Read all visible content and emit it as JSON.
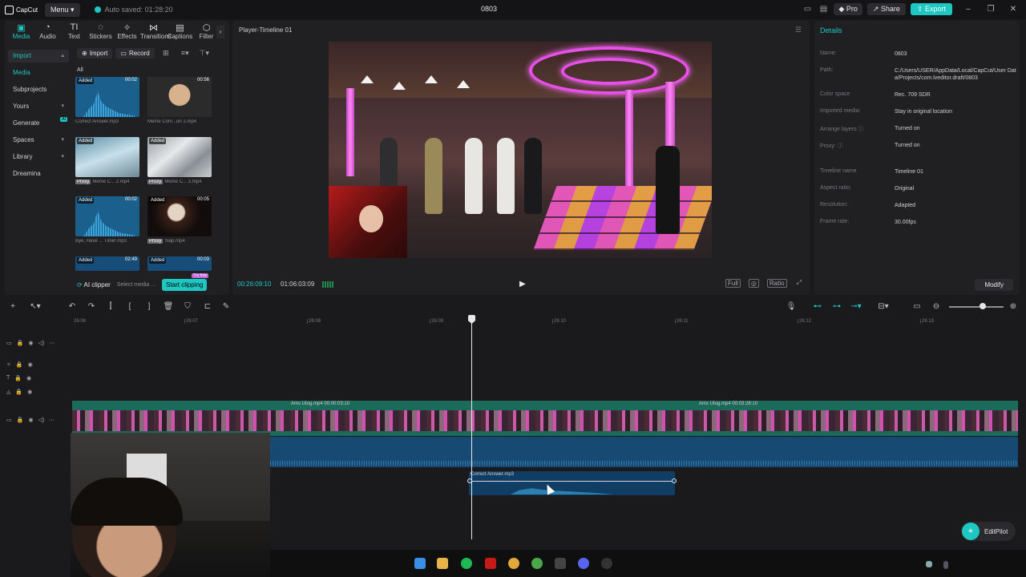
{
  "titlebar": {
    "logo": "CapCut",
    "menu": "Menu",
    "autosave": "Auto saved: 01:28:20",
    "project": "0803",
    "pro": "Pro",
    "share": "Share",
    "export": "Export"
  },
  "tools": [
    {
      "label": "Media",
      "icon": "media-icon"
    },
    {
      "label": "Audio",
      "icon": "audio-icon"
    },
    {
      "label": "Text",
      "icon": "text-icon"
    },
    {
      "label": "Stickers",
      "icon": "sticker-icon"
    },
    {
      "label": "Effects",
      "icon": "effects-icon"
    },
    {
      "label": "Transitions",
      "icon": "transitions-icon"
    },
    {
      "label": "Captions",
      "icon": "captions-icon"
    },
    {
      "label": "Filter",
      "icon": "filter-icon"
    }
  ],
  "sidebar": {
    "import": "Import",
    "media": "Media",
    "subprojects": "Subprojects",
    "yours": "Yours",
    "generate": "Generate",
    "generate_badge": "AI",
    "spaces": "Spaces",
    "library": "Library",
    "dreamina": "Dreamina"
  },
  "media_toolbar": {
    "import": "Import",
    "record": "Record"
  },
  "media": {
    "all": "All",
    "added": "Added",
    "proxy": "Proxy",
    "items": [
      {
        "name": "Correct Answer.mp3",
        "duration": "00:02"
      },
      {
        "name": "Meme Com...on 1.mp4",
        "duration": "00:56"
      },
      {
        "name": "Meme C... 2.mp4",
        "duration": ""
      },
      {
        "name": "Meme C... 3.mp4",
        "duration": ""
      },
      {
        "name": "Bye, Have ... Time!.mp3",
        "duration": "00:02"
      },
      {
        "name": "Slap.mp4",
        "duration": "00:05"
      },
      {
        "name": "",
        "duration": "02:49"
      },
      {
        "name": "",
        "duration": "00:03"
      }
    ]
  },
  "left_footer": {
    "ai_clipper": "AI clipper",
    "select_media": "Select media ...",
    "start_clipping": "Start clipping",
    "try_free": "Try free"
  },
  "player": {
    "title": "Player-Timeline 01",
    "current_time": "00:26:09:10",
    "total_time": "01:06:03:09",
    "full": "Full",
    "ratio": "Ratio"
  },
  "details": {
    "title": "Details",
    "rows": [
      {
        "label": "Name:",
        "value": "0803"
      },
      {
        "label": "Path:",
        "value": "C:/Users/USER/AppData/Local/CapCut/User Data/Projects/com.lveditor.draft/0803"
      },
      {
        "label": "Color space",
        "value": "Rec. 709 SDR"
      },
      {
        "label": "Imported media:",
        "value": "Stay in original location"
      },
      {
        "label": "Arrange layers",
        "value": "Turned on"
      },
      {
        "label": "Proxy:",
        "value": "Turned on"
      },
      {
        "label": "Timeline name",
        "value": "Timeline 01"
      },
      {
        "label": "Aspect ratio:",
        "value": "Original"
      },
      {
        "label": "Resolution:",
        "value": "Adapted"
      },
      {
        "label": "Frame rate:",
        "value": "30.00fps"
      }
    ],
    "modify": "Modify"
  },
  "ruler": [
    "26:06",
    "26:07",
    "26:08",
    "26:09",
    "26:10",
    "26:11",
    "26:12",
    "26:13"
  ],
  "timeline": {
    "clip1_label": "Ams Utog.mp4  00:00:03:10",
    "clip2_label": "Ams Utog.mp4  00:03:28:10",
    "audio_clip_label": "Correct Answer.mp3"
  },
  "editpilot": "EditPilot",
  "colors": {
    "accent": "#1fc7c2",
    "panel": "#202023",
    "background": "#1a1a1c"
  }
}
